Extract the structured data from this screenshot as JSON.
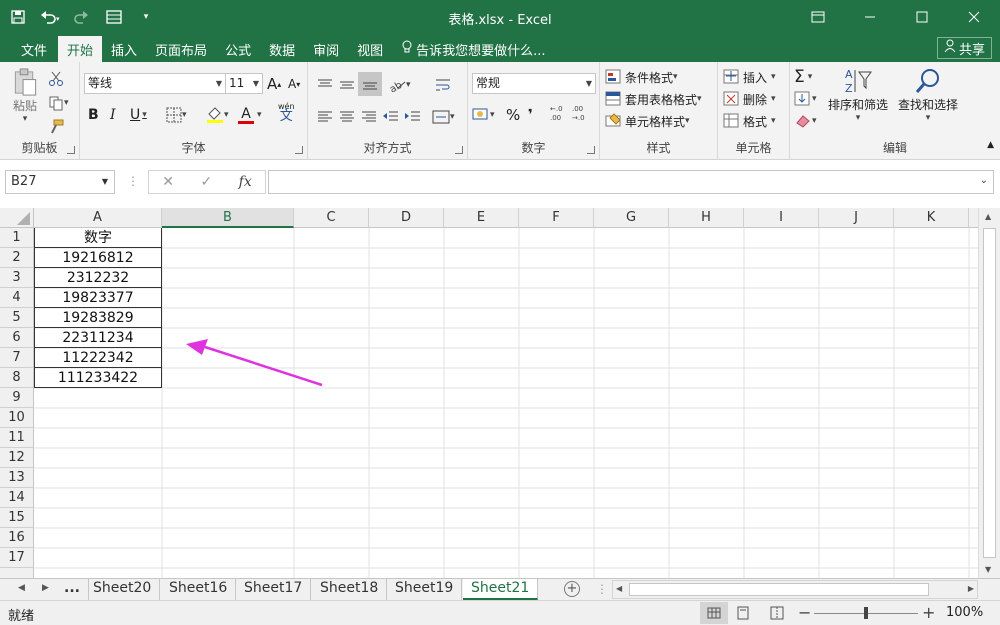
{
  "window": {
    "title": "表格.xlsx - Excel"
  },
  "ribbon_tabs": [
    "文件",
    "开始",
    "插入",
    "页面布局",
    "公式",
    "数据",
    "审阅",
    "视图"
  ],
  "tell_me": "告诉我您想要做什么...",
  "share": "共享",
  "clipboard": {
    "paste": "粘贴",
    "label": "剪贴板"
  },
  "font": {
    "name": "等线",
    "size": "11",
    "label": "字体",
    "bold": "B",
    "italic": "I",
    "underline": "U",
    "grow": "A",
    "shrink": "A",
    "color_a": "A",
    "wen": "wén",
    "wen_char": "文"
  },
  "align": {
    "label": "对齐方式"
  },
  "number": {
    "format": "常规",
    "label": "数字",
    "percent": "%",
    "comma": "❜"
  },
  "styles": {
    "cond": "条件格式",
    "table": "套用表格格式",
    "cell": "单元格样式",
    "label": "样式"
  },
  "cells": {
    "insert": "插入",
    "delete": "删除",
    "format": "格式",
    "label": "单元格"
  },
  "editing": {
    "sum": "Σ",
    "sort": "排序和筛选",
    "find": "查找和选择",
    "label": "编辑"
  },
  "namebox": "B27",
  "fx": "fx",
  "columns": [
    "A",
    "B",
    "C",
    "D",
    "E",
    "F",
    "G",
    "H",
    "I",
    "J",
    "K"
  ],
  "rows": [
    "1",
    "2",
    "3",
    "4",
    "5",
    "6",
    "7",
    "8",
    "9",
    "10",
    "11",
    "12",
    "13",
    "14",
    "15",
    "16",
    "17"
  ],
  "cells_a": [
    "数字",
    "19216812",
    "2312232",
    "19823377",
    "19283829",
    "22311234",
    "11222342",
    "111233422"
  ],
  "sheets": [
    "...",
    "Sheet20",
    "Sheet16",
    "Sheet17",
    "Sheet18",
    "Sheet19",
    "Sheet21"
  ],
  "status": {
    "ready": "就绪",
    "zoom": "100%"
  },
  "colors": {
    "accent": "#217346",
    "arrow": "#e033e0"
  }
}
